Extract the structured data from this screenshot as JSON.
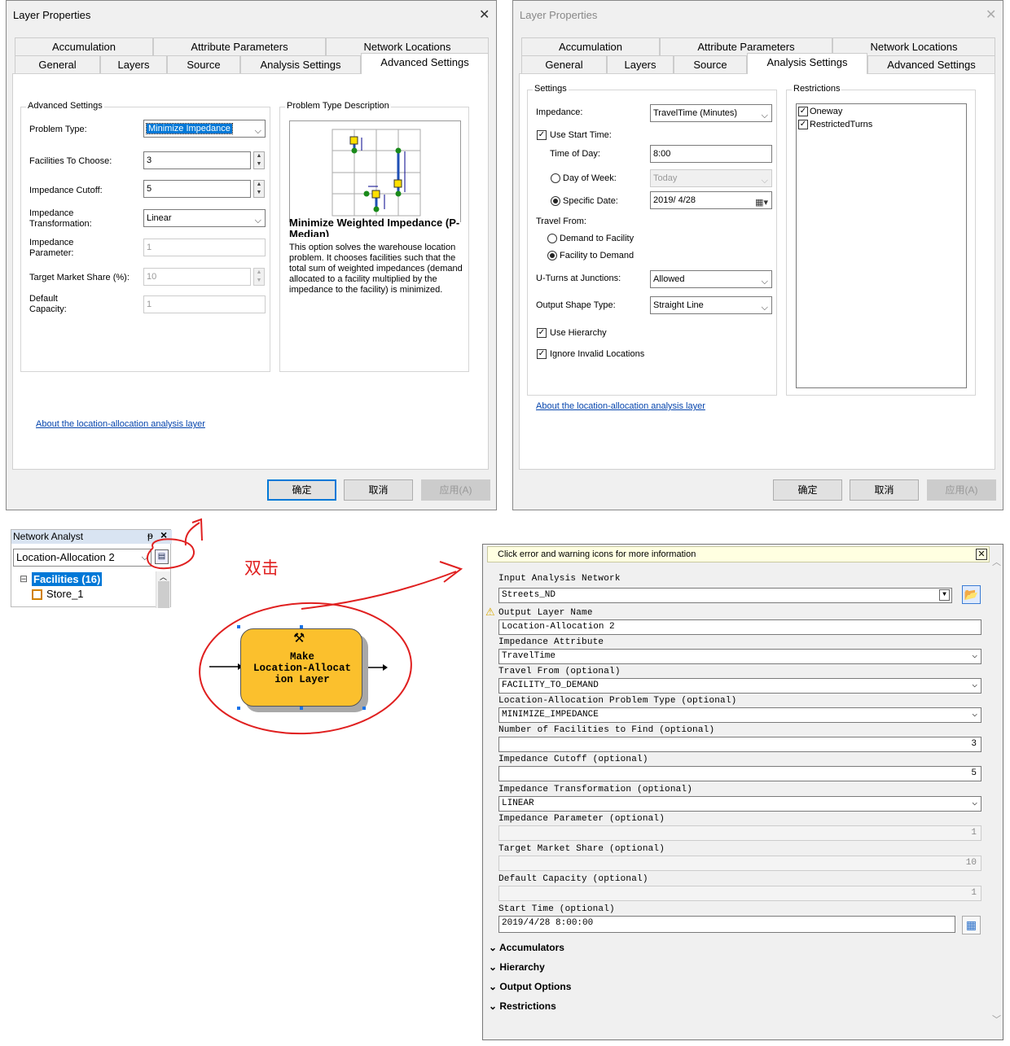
{
  "left_dialog": {
    "title": "Layer Properties",
    "tabs_row1": [
      "Accumulation",
      "Attribute Parameters",
      "Network Locations"
    ],
    "tabs_row2": [
      "General",
      "Layers",
      "Source",
      "Analysis Settings",
      "Advanced Settings"
    ],
    "selected_tab": "Advanced Settings",
    "group_title": "Advanced Settings",
    "problem_type_label": "Problem Type:",
    "problem_type_value": "Minimize Impedance",
    "facilities_label": "Facilities To Choose:",
    "facilities_value": "3",
    "cutoff_label": "Impedance Cutoff:",
    "cutoff_value": "5",
    "transformation_label": "Impedance Transformation:",
    "transformation_value": "Linear",
    "parameter_label": "Impedance Parameter:",
    "parameter_value": "1",
    "market_share_label": "Target Market Share (%):",
    "market_share_value": "10",
    "capacity_label": "Default Capacity:",
    "capacity_value": "1",
    "desc_group_title": "Problem Type Description",
    "desc_heading": "Minimize Weighted Impedance (P-Median)",
    "desc_text": "This option solves the warehouse location problem. It chooses facilities such that the total sum of weighted impedances (demand allocated to a facility multiplied by the impedance to the facility) is minimized.",
    "about_link": "About the location-allocation analysis layer",
    "ok": "确定",
    "cancel": "取消",
    "apply": "应用(A)"
  },
  "right_dialog": {
    "title": "Layer Properties",
    "tabs_row1": [
      "Accumulation",
      "Attribute Parameters",
      "Network Locations"
    ],
    "tabs_row2": [
      "General",
      "Layers",
      "Source",
      "Analysis Settings",
      "Advanced Settings"
    ],
    "selected_tab": "Analysis Settings",
    "settings_title": "Settings",
    "impedance_label": "Impedance:",
    "impedance_value": "TravelTime (Minutes)",
    "use_start_time": "Use Start Time:",
    "time_of_day_label": "Time of Day:",
    "time_of_day_value": "8:00",
    "day_of_week_label": "Day of Week:",
    "day_of_week_value": "Today",
    "specific_date_label": "Specific Date:",
    "specific_date_value": "2019/  4/28",
    "travel_from_label": "Travel From:",
    "demand_to_facility": "Demand to Facility",
    "facility_to_demand": "Facility to Demand",
    "uturns_label": "U-Turns at Junctions:",
    "uturns_value": "Allowed",
    "output_shape_label": "Output Shape Type:",
    "output_shape_value": "Straight Line",
    "use_hierarchy": "Use Hierarchy",
    "ignore_invalid": "Ignore Invalid Locations",
    "restrictions_title": "Restrictions",
    "restrictions": [
      "Oneway",
      "RestrictedTurns"
    ],
    "about_link": "About the location-allocation analysis layer",
    "ok": "确定",
    "cancel": "取消",
    "apply": "应用(A)"
  },
  "network_analyst": {
    "title": "Network Analyst",
    "pin": "ᵽ",
    "close": "×",
    "layer_select": "Location-Allocation 2",
    "tree_expander": "⊟",
    "tree_root": "Facilities (16)",
    "tree_child": "Store_1"
  },
  "annotation": {
    "double_click": "双击"
  },
  "model_node": {
    "label": "Make Location-Allocation Layer",
    "label_lines": [
      "Make",
      "Location-Allocat",
      "ion Layer"
    ]
  },
  "gp_tool": {
    "banner": "Click error and warning icons for more information",
    "input_network_label": "Input Analysis Network",
    "input_network_value": "Streets_ND",
    "output_layer_label": "Output Layer Name",
    "output_layer_value": "Location-Allocation 2",
    "impedance_attr_label": "Impedance Attribute",
    "impedance_attr_value": "TravelTime",
    "travel_from_label": "Travel From (optional)",
    "travel_from_value": "FACILITY_TO_DEMAND",
    "problem_type_label": "Location-Allocation Problem Type (optional)",
    "problem_type_value": "MINIMIZE_IMPEDANCE",
    "num_facilities_label": "Number of Facilities to Find (optional)",
    "num_facilities_value": "3",
    "cutoff_label": "Impedance Cutoff (optional)",
    "cutoff_value": "5",
    "transformation_label": "Impedance Transformation (optional)",
    "transformation_value": "LINEAR",
    "parameter_label": "Impedance Parameter (optional)",
    "parameter_value": "1",
    "market_share_label": "Target Market Share (optional)",
    "market_share_value": "10",
    "capacity_label": "Default Capacity (optional)",
    "capacity_value": "1",
    "start_time_label": "Start Time (optional)",
    "start_time_value": "2019/4/28 8:00:00",
    "sections": [
      "Accumulators",
      "Hierarchy",
      "Output Options",
      "Restrictions"
    ]
  },
  "colors": {
    "accent": "#0078d7",
    "annotation_red": "#e02020",
    "model_node": "#fbc02d",
    "link": "#0645ad",
    "banner_bg": "#ffffe1"
  }
}
